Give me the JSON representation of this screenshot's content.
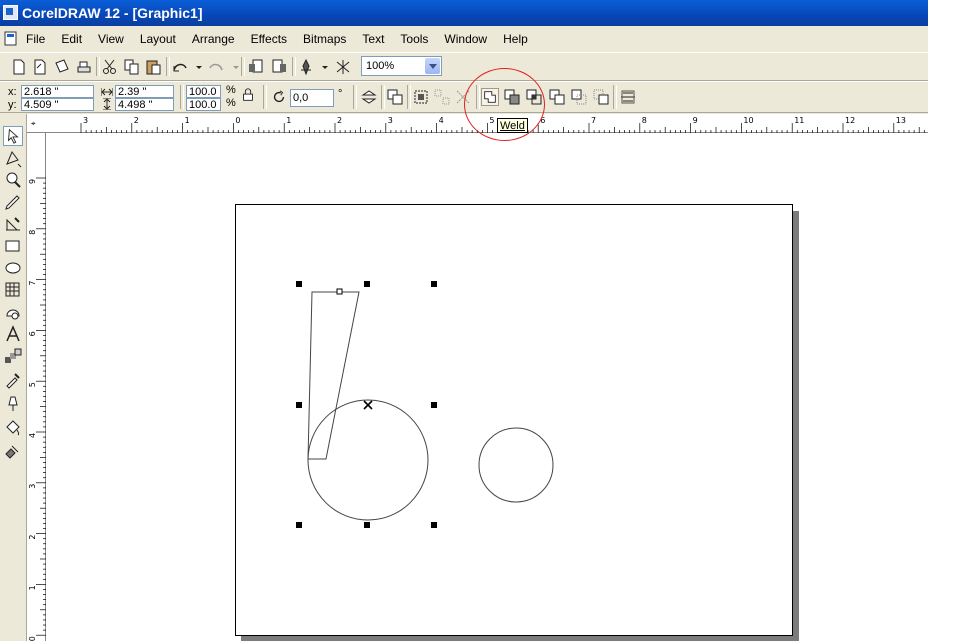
{
  "window": {
    "title": "CorelDRAW 12 - [Graphic1]"
  },
  "menu": [
    "File",
    "Edit",
    "View",
    "Layout",
    "Arrange",
    "Effects",
    "Bitmaps",
    "Text",
    "Tools",
    "Window",
    "Help"
  ],
  "toolbar": {
    "zoom": "100%"
  },
  "property_bar": {
    "x_label": "x:",
    "x_value": "2.618 \"",
    "y_label": "y:",
    "y_value": "4.509 \"",
    "width_value": "2.39 \"",
    "height_value": "4.498 \"",
    "scale_x": "100.0",
    "scale_y": "100.0",
    "percent": "%",
    "rotation_value": "0,0",
    "degree": "°"
  },
  "tooltip": {
    "text": "Weld"
  },
  "ruler": {
    "h_labels": [
      "3",
      "2",
      "1",
      "0",
      "1",
      "2",
      "3",
      "4",
      "5",
      "6",
      "7",
      "8",
      "9",
      "10",
      "11",
      "12",
      "13"
    ],
    "v_labels": [
      "9",
      "8",
      "7",
      "6",
      "5",
      "4",
      "3",
      "2",
      "1",
      "0"
    ]
  },
  "icons": {
    "tools": [
      "pick-tool-icon",
      "shape-tool-icon",
      "zoom-tool-icon",
      "freehand-tool-icon",
      "smart-fill-tool-icon",
      "rectangle-tool-icon",
      "ellipse-tool-icon",
      "graph-paper-tool-icon",
      "basic-shapes-tool-icon",
      "text-tool-icon",
      "interactive-blend-tool-icon",
      "eyedropper-tool-icon",
      "outline-tool-icon",
      "fill-tool-icon",
      "interactive-fill-tool-icon"
    ]
  },
  "colors": {
    "title_bar": "#0a5fd8",
    "annotation": "#e02020",
    "tooltip_bg": "#ffffe1",
    "chrome": "#ece9d8"
  }
}
